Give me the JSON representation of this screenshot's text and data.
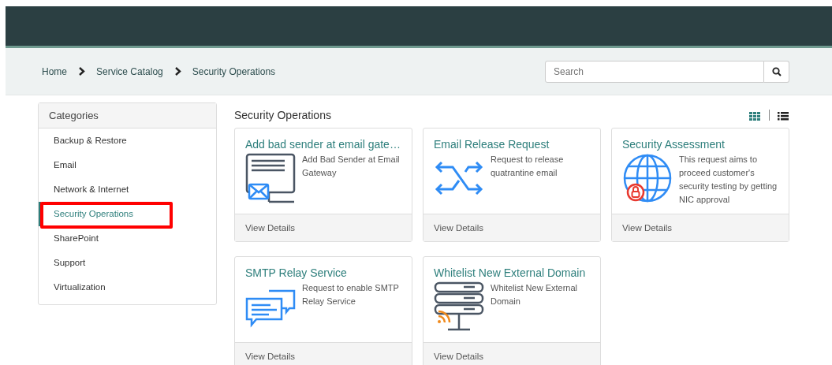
{
  "breadcrumb": [
    {
      "label": "Home"
    },
    {
      "label": "Service Catalog"
    },
    {
      "label": "Security Operations"
    }
  ],
  "search": {
    "placeholder": "Search"
  },
  "categories": {
    "title": "Categories",
    "items": [
      {
        "label": "Backup & Restore",
        "selected": false,
        "highlighted": false
      },
      {
        "label": "Email",
        "selected": false,
        "highlighted": false
      },
      {
        "label": "Network & Internet",
        "selected": false,
        "highlighted": false
      },
      {
        "label": "Security Operations",
        "selected": true,
        "highlighted": true
      },
      {
        "label": "SharePoint",
        "selected": false,
        "highlighted": false
      },
      {
        "label": "Support",
        "selected": false,
        "highlighted": false
      },
      {
        "label": "Virtualization",
        "selected": false,
        "highlighted": false
      }
    ]
  },
  "section_title": "Security Operations",
  "view_modes": [
    {
      "kind": "grid",
      "selected": true
    },
    {
      "kind": "list",
      "selected": false
    }
  ],
  "cards": [
    {
      "kind": "monitor-mail",
      "title": "Add bad sender at email gate…",
      "description": "Add Bad Sender at Email Gateway",
      "footer": "View Details"
    },
    {
      "kind": "shuffle",
      "title": "Email Release Request",
      "description": "Request to release quatrantine email",
      "footer": "View Details"
    },
    {
      "kind": "globe-lock",
      "title": "Security Assessment",
      "description": "This request aims to proceed customer's security testing by getting NIC approval",
      "footer": "View Details"
    },
    {
      "kind": "chat",
      "title": "SMTP Relay Service",
      "description": "Request to enable SMTP Relay Service",
      "footer": "View Details"
    },
    {
      "kind": "server",
      "title": "Whitelist New External Domain",
      "description": "Whitelist New External Domain",
      "footer": "View Details"
    }
  ]
}
